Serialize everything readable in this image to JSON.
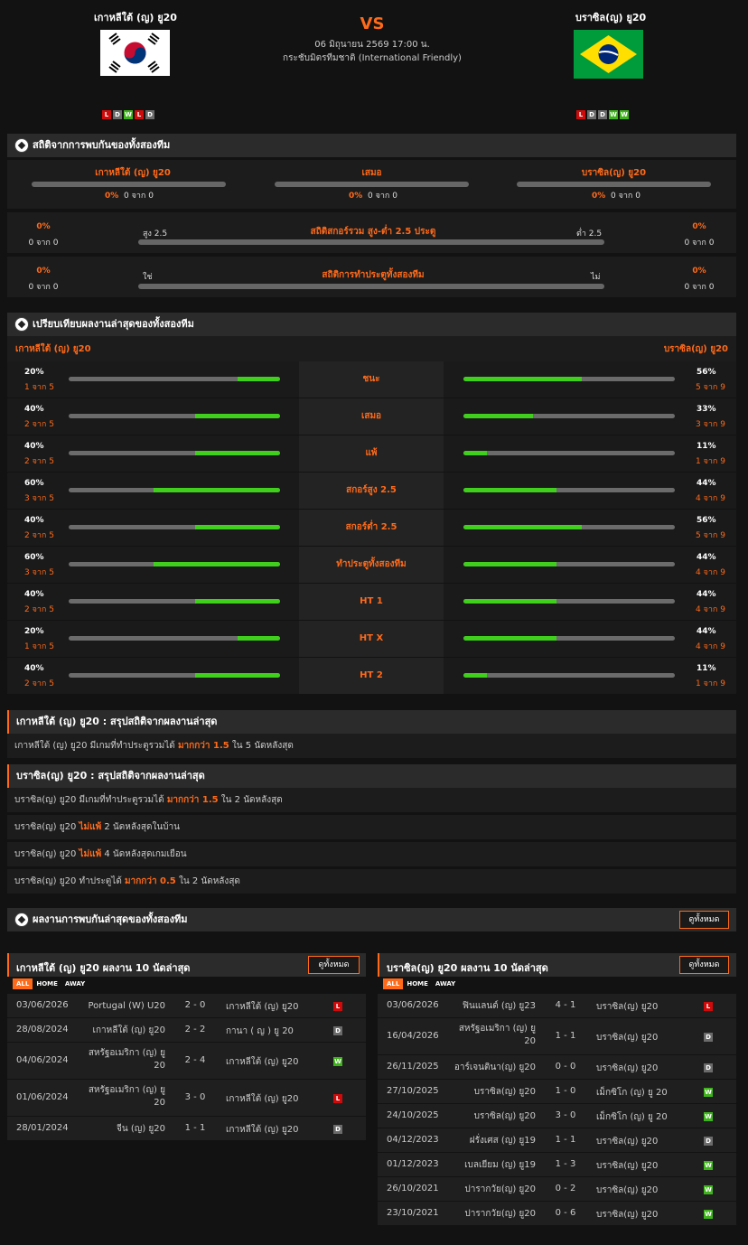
{
  "header": {
    "home": "เกาหลีใต้ (ญ) ยู20",
    "away": "บราซิล(ญ) ยู20",
    "vs": "VS",
    "datetime": "06 มิถุนายน 2569 17:00 น.",
    "competition": "กระชับมิตรทีมชาติ (International Friendly)",
    "home_form": [
      "L",
      "D",
      "W",
      "L",
      "D"
    ],
    "away_form": [
      "L",
      "D",
      "D",
      "W",
      "W"
    ]
  },
  "h2h": {
    "title": "สถิติจากการพบกันของทั้งสองทีม",
    "home": "เกาหลีใต้ (ญ) ยู20",
    "draw": "เสมอ",
    "away": "บราซิล(ญ) ยู20",
    "home_pct": "0%",
    "home_of": "0 จาก 0",
    "draw_pct": "0%",
    "draw_of": "0 จาก 0",
    "away_pct": "0%",
    "away_of": "0 จาก 0",
    "ou_title": "สถิติสกอร์รวม สูง-ต่ำ 2.5 ประตู",
    "ou_left": "สูง 2.5",
    "ou_right": "ต่ำ 2.5",
    "ou_lpct": "0%",
    "ou_lof": "0 จาก 0",
    "ou_rpct": "0%",
    "ou_rof": "0 จาก 0",
    "bt_title": "สถิติการทำประตูทั้งสองทีม",
    "bt_left": "ใช่",
    "bt_right": "ไม่",
    "bt_lpct": "0%",
    "bt_lof": "0 จาก 0",
    "bt_rpct": "0%",
    "bt_rof": "0 จาก 0"
  },
  "compare": {
    "title": "เปรียบเทียบผลงานล่าสุดของทั้งสองทีม",
    "home": "เกาหลีใต้ (ญ) ยู20",
    "away": "บราซิล(ญ) ยู20",
    "rows": [
      {
        "label": "ชนะ",
        "lp": "20%",
        "lof": "1 จาก 5",
        "lv": 0.2,
        "rp": "56%",
        "rof": "5 จาก 9",
        "rv": 0.56
      },
      {
        "label": "เสมอ",
        "lp": "40%",
        "lof": "2 จาก 5",
        "lv": 0.4,
        "rp": "33%",
        "rof": "3 จาก 9",
        "rv": 0.33
      },
      {
        "label": "แพ้",
        "lp": "40%",
        "lof": "2 จาก 5",
        "lv": 0.4,
        "rp": "11%",
        "rof": "1 จาก 9",
        "rv": 0.11
      },
      {
        "label": "สกอร์สูง 2.5",
        "lp": "60%",
        "lof": "3 จาก 5",
        "lv": 0.6,
        "rp": "44%",
        "rof": "4 จาก 9",
        "rv": 0.44
      },
      {
        "label": "สกอร์ต่ำ 2.5",
        "lp": "40%",
        "lof": "2 จาก 5",
        "lv": 0.4,
        "rp": "56%",
        "rof": "5 จาก 9",
        "rv": 0.56
      },
      {
        "label": "ทำประตูทั้งสองทีม",
        "lp": "60%",
        "lof": "3 จาก 5",
        "lv": 0.6,
        "rp": "44%",
        "rof": "4 จาก 9",
        "rv": 0.44
      },
      {
        "label": "HT 1",
        "lp": "40%",
        "lof": "2 จาก 5",
        "lv": 0.4,
        "rp": "44%",
        "rof": "4 จาก 9",
        "rv": 0.44
      },
      {
        "label": "HT X",
        "lp": "20%",
        "lof": "1 จาก 5",
        "lv": 0.2,
        "rp": "44%",
        "rof": "4 จาก 9",
        "rv": 0.44
      },
      {
        "label": "HT 2",
        "lp": "40%",
        "lof": "2 จาก 5",
        "lv": 0.4,
        "rp": "11%",
        "rof": "1 จาก 9",
        "rv": 0.11
      }
    ]
  },
  "summary_home": {
    "title": "เกาหลีใต้ (ญ) ยู20 : สรุปสถิติจากผลงานล่าสุด",
    "l1a": "เกาหลีใต้ (ญ) ยู20  มีเกมที่ทำประตูรวมได้ ",
    "l1b": "มากกว่า  1.5",
    "l1c": "  ใน 5 นัดหลังสุด"
  },
  "summary_away": {
    "title": "บราซิล(ญ) ยู20 : สรุปสถิติจากผลงานล่าสุด",
    "l1a": "บราซิล(ญ) ยู20  มีเกมที่ทำประตูรวมได้ ",
    "l1b": "มากกว่า  1.5",
    "l1c": "  ใน 2 นัดหลังสุด",
    "l2a": "บราซิล(ญ) ยู20 ",
    "l2b": "ไม่แพ้",
    "l2c": "  2  นัดหลังสุดในบ้าน",
    "l3a": "บราซิล(ญ) ยู20 ",
    "l3b": "ไม่แพ้",
    "l3c": "  4  นัดหลังสุดเกมเยือน",
    "l4a": "บราซิล(ญ) ยู20  ทำประตูได้ ",
    "l4b": "มากกว่า  0.5",
    "l4c": "  ใน 2 นัดหลังสุด"
  },
  "recent": {
    "title": "ผลงานการพบกันล่าสุดของทั้งสองทีม",
    "view_all": "ดูทั้งหมด"
  },
  "home_last": {
    "title": "เกาหลีใต้ (ญ) ยู20 ผลงาน 10 นัดล่าสุด",
    "view_all": "ดูทั้งหมด",
    "tabs": [
      "ALL",
      "HOME",
      "AWAY"
    ],
    "matches": [
      {
        "date": "03/06/2026",
        "home": "Portugal (W) U20",
        "score": "2 - 0",
        "away": "เกาหลีใต้ (ญ) ยู20",
        "res": "L"
      },
      {
        "date": "28/08/2024",
        "home": "เกาหลีใต้ (ญ) ยู20",
        "score": "2 - 2",
        "away": "กานา ( ญ ) ยู 20",
        "res": "D"
      },
      {
        "date": "04/06/2024",
        "home": "สหรัฐอเมริกา (ญ) ยู 20",
        "score": "2 - 4",
        "away": "เกาหลีใต้ (ญ) ยู20",
        "res": "W"
      },
      {
        "date": "01/06/2024",
        "home": "สหรัฐอเมริกา (ญ) ยู 20",
        "score": "3 - 0",
        "away": "เกาหลีใต้ (ญ) ยู20",
        "res": "L"
      },
      {
        "date": "28/01/2024",
        "home": "จีน (ญ) ยู20",
        "score": "1 - 1",
        "away": "เกาหลีใต้ (ญ) ยู20",
        "res": "D"
      }
    ]
  },
  "away_last": {
    "title": "บราซิล(ญ) ยู20 ผลงาน 10 นัดล่าสุด",
    "view_all": "ดูทั้งหมด",
    "tabs": [
      "ALL",
      "HOME",
      "AWAY"
    ],
    "matches": [
      {
        "date": "03/06/2026",
        "home": "ฟินแลนด์ (ญ) ยู23",
        "score": "4 - 1",
        "away": "บราซิล(ญ) ยู20",
        "res": "L"
      },
      {
        "date": "16/04/2026",
        "home": "สหรัฐอเมริกา (ญ) ยู 20",
        "score": "1 - 1",
        "away": "บราซิล(ญ) ยู20",
        "res": "D"
      },
      {
        "date": "26/11/2025",
        "home": "อาร์เจนตินา(ญ) ยู20",
        "score": "0 - 0",
        "away": "บราซิล(ญ) ยู20",
        "res": "D"
      },
      {
        "date": "27/10/2025",
        "home": "บราซิล(ญ) ยู20",
        "score": "1 - 0",
        "away": "เม็กซิโก (ญ) ยู 20",
        "res": "W"
      },
      {
        "date": "24/10/2025",
        "home": "บราซิล(ญ) ยู20",
        "score": "3 - 0",
        "away": "เม็กซิโก (ญ) ยู 20",
        "res": "W"
      },
      {
        "date": "04/12/2023",
        "home": "ฝรั่งเศส (ญ) ยู19",
        "score": "1 - 1",
        "away": "บราซิล(ญ) ยู20",
        "res": "D"
      },
      {
        "date": "01/12/2023",
        "home": "เบลเยียม (ญ) ยู19",
        "score": "1 - 3",
        "away": "บราซิล(ญ) ยู20",
        "res": "W"
      },
      {
        "date": "26/10/2021",
        "home": "ปารากวัย(ญ) ยู20",
        "score": "0 - 2",
        "away": "บราซิล(ญ) ยู20",
        "res": "W"
      },
      {
        "date": "23/10/2021",
        "home": "ปารากวัย(ญ) ยู20",
        "score": "0 - 6",
        "away": "บราซิล(ญ) ยู20",
        "res": "W"
      }
    ]
  }
}
